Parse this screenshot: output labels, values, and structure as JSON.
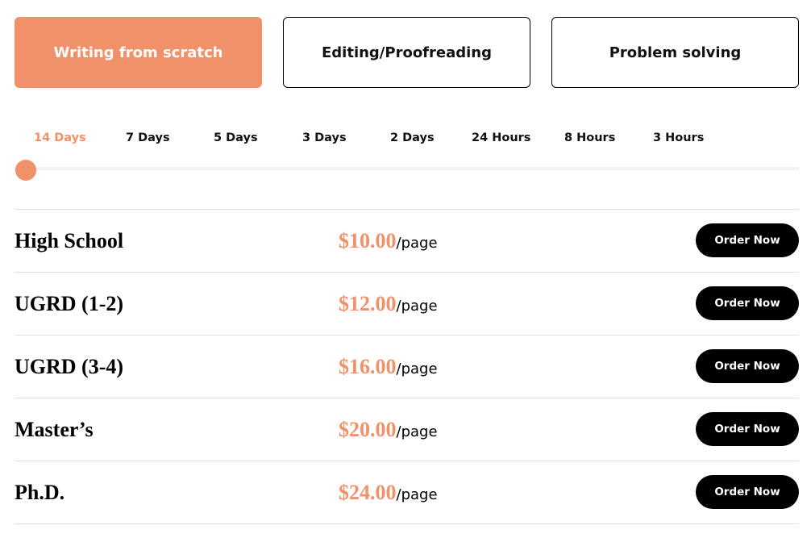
{
  "colors": {
    "accent": "#f0916a",
    "text": "#000000",
    "button_bg": "#000000",
    "divider": "#e2e0da",
    "track": "#f2f2f2"
  },
  "service_tabs": [
    {
      "label": "Writing from scratch",
      "active": true
    },
    {
      "label": "Editing/Proofreading",
      "active": false
    },
    {
      "label": "Problem solving",
      "active": false
    }
  ],
  "deadlines": {
    "options": [
      "14 Days",
      "7 Days",
      "5 Days",
      "3 Days",
      "2 Days",
      "24 Hours",
      "8 Hours",
      "3 Hours"
    ],
    "selected_index": 0,
    "selected": "14 Days"
  },
  "pricing": {
    "rows": [
      {
        "level": "High School",
        "price": "$10.00",
        "unit": "/page",
        "button": "Order Now"
      },
      {
        "level": "UGRD (1-2)",
        "price": "$12.00",
        "unit": "/page",
        "button": "Order Now"
      },
      {
        "level": "UGRD (3-4)",
        "price": "$16.00",
        "unit": "/page",
        "button": "Order Now"
      },
      {
        "level": "Master’s",
        "price": "$20.00",
        "unit": "/page",
        "button": "Order Now"
      },
      {
        "level": "Ph.D.",
        "price": "$24.00",
        "unit": "/page",
        "button": "Order Now"
      }
    ]
  }
}
